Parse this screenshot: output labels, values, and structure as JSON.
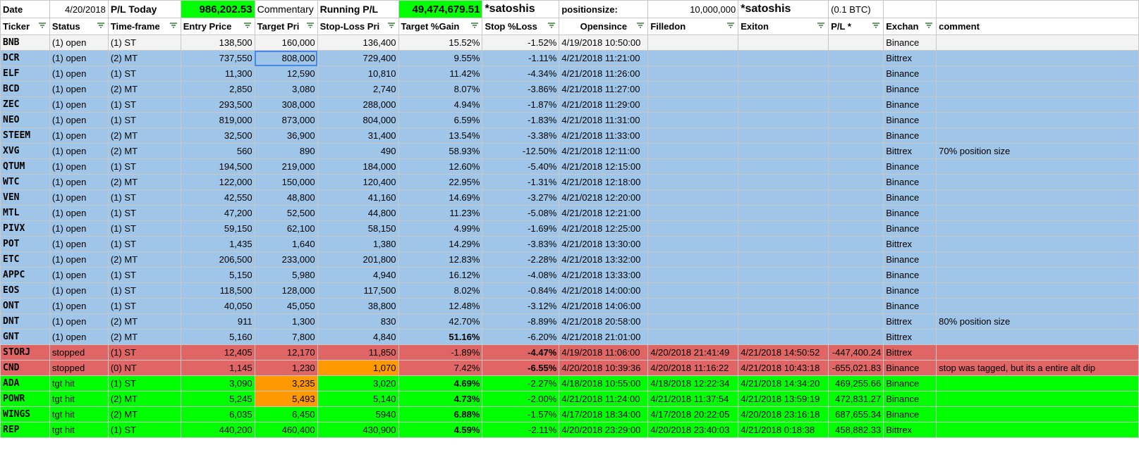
{
  "summary": {
    "date_label": "Date",
    "date_value": "4/20/2018",
    "pl_today_label": "P/L Today",
    "pl_today_value": "986,202.53",
    "commentary_label": "Commentary",
    "running_pl_label": "Running P/L",
    "running_pl_value": "49,474,679.51",
    "satoshis_1": "*satoshis",
    "positionsize_label": "positionsize:",
    "positionsize_value": "10,000,000",
    "satoshis_2": "*satoshis",
    "btc_note": "(0.1 BTC)"
  },
  "headers": [
    "Ticker",
    "Status",
    "Time-frame",
    "Entry Price",
    "Target Pri",
    "Stop-Loss Pri",
    "Target %Gain",
    "Stop %Loss",
    "Opensince",
    "Filledon",
    "Exiton",
    "P/L *",
    "Exchan",
    "comment"
  ],
  "colors": {
    "open": "#9fc5e8",
    "stopped": "#e06666",
    "hit": "#00ff00",
    "highlight": "#ff9900",
    "money": "#00ff00"
  },
  "icons": {
    "filter": "filter-icon"
  },
  "rows": [
    {
      "ticker": "BNB",
      "status": "(1) open",
      "tf": "(1) ST",
      "entry": "138,500",
      "target": "160,000",
      "stop": "136,400",
      "gain": "15.52%",
      "loss": "-1.52%",
      "open": "4/19/2018 10:50:00",
      "filled": "",
      "exit": "",
      "pl": "",
      "exch": "Binance",
      "comment": ""
    },
    {
      "ticker": "DCR",
      "status": "(1) open",
      "tf": "(2) MT",
      "entry": "737,550",
      "target": "808,000",
      "stop": "729,400",
      "gain": "9.55%",
      "loss": "-1.11%",
      "open": "4/21/2018 11:21:00",
      "filled": "",
      "exit": "",
      "pl": "",
      "exch": "Bittrex",
      "comment": ""
    },
    {
      "ticker": "ELF",
      "status": "(1) open",
      "tf": "(1) ST",
      "entry": "11,300",
      "target": "12,590",
      "stop": "10,810",
      "gain": "11.42%",
      "loss": "-4.34%",
      "open": "4/21/2018 11:26:00",
      "filled": "",
      "exit": "",
      "pl": "",
      "exch": "Binance",
      "comment": ""
    },
    {
      "ticker": "BCD",
      "status": "(1) open",
      "tf": "(2) MT",
      "entry": "2,850",
      "target": "3,080",
      "stop": "2,740",
      "gain": "8.07%",
      "loss": "-3.86%",
      "open": "4/21/2018 11:27:00",
      "filled": "",
      "exit": "",
      "pl": "",
      "exch": "Binance",
      "comment": ""
    },
    {
      "ticker": "ZEC",
      "status": "(1) open",
      "tf": "(1) ST",
      "entry": "293,500",
      "target": "308,000",
      "stop": "288,000",
      "gain": "4.94%",
      "loss": "-1.87%",
      "open": "4/21/2018 11:29:00",
      "filled": "",
      "exit": "",
      "pl": "",
      "exch": "Binance",
      "comment": ""
    },
    {
      "ticker": "NEO",
      "status": "(1) open",
      "tf": "(1) ST",
      "entry": "819,000",
      "target": "873,000",
      "stop": "804,000",
      "gain": "6.59%",
      "loss": "-1.83%",
      "open": "4/21/2018 11:31:00",
      "filled": "",
      "exit": "",
      "pl": "",
      "exch": "Binance",
      "comment": ""
    },
    {
      "ticker": "STEEM",
      "status": "(1) open",
      "tf": "(2) MT",
      "entry": "32,500",
      "target": "36,900",
      "stop": "31,400",
      "gain": "13.54%",
      "loss": "-3.38%",
      "open": "4/21/2018 11:33:00",
      "filled": "",
      "exit": "",
      "pl": "",
      "exch": "Binance",
      "comment": ""
    },
    {
      "ticker": "XVG",
      "status": "(1) open",
      "tf": "(2) MT",
      "entry": "560",
      "target": "890",
      "stop": "490",
      "gain": "58.93%",
      "loss": "-12.50%",
      "open": "4/21/2018 12:11:00",
      "filled": "",
      "exit": "",
      "pl": "",
      "exch": "Bittrex",
      "comment": "70% position size"
    },
    {
      "ticker": "QTUM",
      "status": "(1) open",
      "tf": "(1) ST",
      "entry": "194,500",
      "target": "219,000",
      "stop": "184,000",
      "gain": "12.60%",
      "loss": "-5.40%",
      "open": "4/21/2018 12:15:00",
      "filled": "",
      "exit": "",
      "pl": "",
      "exch": "Binance",
      "comment": ""
    },
    {
      "ticker": "WTC",
      "status": "(1) open",
      "tf": "(2) MT",
      "entry": "122,000",
      "target": "150,000",
      "stop": "120,400",
      "gain": "22.95%",
      "loss": "-1.31%",
      "open": "4/21/2018 12:18:00",
      "filled": "",
      "exit": "",
      "pl": "",
      "exch": "Binance",
      "comment": ""
    },
    {
      "ticker": "VEN",
      "status": "(1) open",
      "tf": "(1) ST",
      "entry": "42,550",
      "target": "48,800",
      "stop": "41,160",
      "gain": "14.69%",
      "loss": "-3.27%",
      "open": "4/21/0218 12:20:00",
      "filled": "",
      "exit": "",
      "pl": "",
      "exch": "Binance",
      "comment": ""
    },
    {
      "ticker": "MTL",
      "status": "(1) open",
      "tf": "(1) ST",
      "entry": "47,200",
      "target": "52,500",
      "stop": "44,800",
      "gain": "11.23%",
      "loss": "-5.08%",
      "open": "4/21/2018 12:21:00",
      "filled": "",
      "exit": "",
      "pl": "",
      "exch": "Binance",
      "comment": ""
    },
    {
      "ticker": "PIVX",
      "status": "(1) open",
      "tf": "(1) ST",
      "entry": "59,150",
      "target": "62,100",
      "stop": "58,150",
      "gain": "4.99%",
      "loss": "-1.69%",
      "open": "4/21/2018 12:25:00",
      "filled": "",
      "exit": "",
      "pl": "",
      "exch": "Binance",
      "comment": ""
    },
    {
      "ticker": "POT",
      "status": "(1) open",
      "tf": "(1) ST",
      "entry": "1,435",
      "target": "1,640",
      "stop": "1,380",
      "gain": "14.29%",
      "loss": "-3.83%",
      "open": "4/21/2018 13:30:00",
      "filled": "",
      "exit": "",
      "pl": "",
      "exch": "Bittrex",
      "comment": ""
    },
    {
      "ticker": "ETC",
      "status": "(1) open",
      "tf": "(2) MT",
      "entry": "206,500",
      "target": "233,000",
      "stop": "201,800",
      "gain": "12.83%",
      "loss": "-2.28%",
      "open": "4/21/2018 13:32:00",
      "filled": "",
      "exit": "",
      "pl": "",
      "exch": "Binance",
      "comment": ""
    },
    {
      "ticker": "APPC",
      "status": "(1) open",
      "tf": "(1) ST",
      "entry": "5,150",
      "target": "5,980",
      "stop": "4,940",
      "gain": "16.12%",
      "loss": "-4.08%",
      "open": "4/21/2018 13:33:00",
      "filled": "",
      "exit": "",
      "pl": "",
      "exch": "Binance",
      "comment": ""
    },
    {
      "ticker": "EOS",
      "status": "(1) open",
      "tf": "(1) ST",
      "entry": "118,500",
      "target": "128,000",
      "stop": "117,500",
      "gain": "8.02%",
      "loss": "-0.84%",
      "open": "4/21/2018 14:00:00",
      "filled": "",
      "exit": "",
      "pl": "",
      "exch": "Binance",
      "comment": ""
    },
    {
      "ticker": "ONT",
      "status": "(1) open",
      "tf": "(1) ST",
      "entry": "40,050",
      "target": "45,050",
      "stop": "38,800",
      "gain": "12.48%",
      "loss": "-3.12%",
      "open": "4/21/2018 14:06:00",
      "filled": "",
      "exit": "",
      "pl": "",
      "exch": "Binance",
      "comment": ""
    },
    {
      "ticker": "DNT",
      "status": "(1) open",
      "tf": "(2) MT",
      "entry": "911",
      "target": "1,300",
      "stop": "830",
      "gain": "42.70%",
      "loss": "-8.89%",
      "open": "4/21/2018 20:58:00",
      "filled": "",
      "exit": "",
      "pl": "",
      "exch": "Bittrex",
      "comment": "80% position size"
    },
    {
      "ticker": "GNT",
      "status": "(1) open",
      "tf": "(2) MT",
      "entry": "5,160",
      "target": "7,800",
      "stop": "4,840",
      "gain": "51.16%",
      "loss": "-6.20%",
      "open": "4/21/2018 21:01:00",
      "filled": "",
      "exit": "",
      "pl": "",
      "exch": "Bittrex",
      "comment": ""
    },
    {
      "ticker": "STORJ",
      "status": "stopped",
      "tf": "(1) ST",
      "entry": "12,405",
      "target": "12,170",
      "stop": "11,850",
      "gain": "-1.89%",
      "loss": "-4.47%",
      "open": "4/19/2018 11:06:00",
      "filled": "4/20/2018 21:41:49",
      "exit": "4/21/2018 14:50:52",
      "pl": "-447,400.24",
      "exch": "Bittrex",
      "comment": ""
    },
    {
      "ticker": "CND",
      "status": "stopped",
      "tf": "(0) NT",
      "entry": "1,145",
      "target": "1,230",
      "stop": "1,070",
      "gain": "7.42%",
      "loss": "-6.55%",
      "open": "4/20/2018 10:39:36",
      "filled": "4/20/2018 11:16:22",
      "exit": "4/21/2018 10:43:18",
      "pl": "-655,021.83",
      "exch": "Binance",
      "comment": "stop was tagged, but its a entire alt dip"
    },
    {
      "ticker": "ADA",
      "status": "tgt hit",
      "tf": "(1) ST",
      "entry": "3,090",
      "target": "3,235",
      "stop": "3,020",
      "gain": "4.69%",
      "loss": "-2.27%",
      "open": "4/18/2018 10:55:00",
      "filled": "4/18/2018 12:22:34",
      "exit": "4/21/2018 14:34:20",
      "pl": "469,255.66",
      "exch": "Binance",
      "comment": ""
    },
    {
      "ticker": "POWR",
      "status": "tgt hit",
      "tf": "(2) MT",
      "entry": "5,245",
      "target": "5,493",
      "stop": "5,140",
      "gain": "4.73%",
      "loss": "-2.00%",
      "open": "4/21/2018 11:24:00",
      "filled": "4/21/2018 11:37:54",
      "exit": "4/21/2018 13:59:19",
      "pl": "472,831.27",
      "exch": "Binance",
      "comment": ""
    },
    {
      "ticker": "WINGS",
      "status": "tgt hit",
      "tf": "(2) MT",
      "entry": "6,035",
      "target": "6,450",
      "stop": "5940",
      "gain": "6.88%",
      "loss": "-1.57%",
      "open": "4/17/2018 18:34:00",
      "filled": "4/17/2018 20:22:05",
      "exit": "4/20/2018 23:16:18",
      "pl": "687,655.34",
      "exch": "Binance",
      "comment": ""
    },
    {
      "ticker": "REP",
      "status": "tgt hit",
      "tf": "(1) ST",
      "entry": "440,200",
      "target": "460,400",
      "stop": "430,900",
      "gain": "4.59%",
      "loss": "-2.11%",
      "open": "4/20/2018 23:29:00",
      "filled": "4/20/2018 23:40:03",
      "exit": "4/21/2018 0:18:38",
      "pl": "458,882.33",
      "exch": "Bittrex",
      "comment": ""
    }
  ]
}
